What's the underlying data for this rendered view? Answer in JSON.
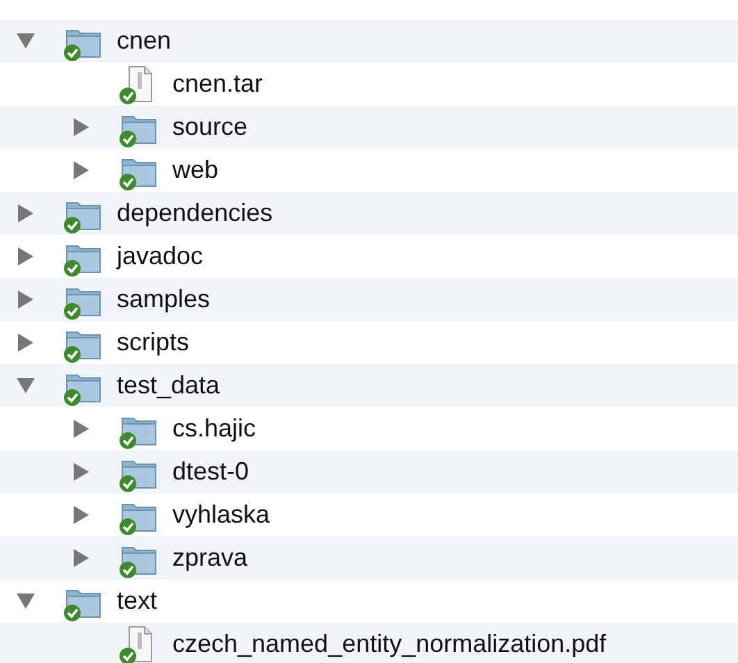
{
  "tree": [
    {
      "kind": "folder",
      "label": "cnen",
      "expanded": true,
      "children": [
        {
          "kind": "file",
          "label": "cnen.tar"
        },
        {
          "kind": "folder",
          "label": "source",
          "expanded": false
        },
        {
          "kind": "folder",
          "label": "web",
          "expanded": false
        }
      ]
    },
    {
      "kind": "folder",
      "label": "dependencies",
      "expanded": false
    },
    {
      "kind": "folder",
      "label": "javadoc",
      "expanded": false
    },
    {
      "kind": "folder",
      "label": "samples",
      "expanded": false
    },
    {
      "kind": "folder",
      "label": "scripts",
      "expanded": false
    },
    {
      "kind": "folder",
      "label": "test_data",
      "expanded": true,
      "children": [
        {
          "kind": "folder",
          "label": "cs.hajic",
          "expanded": false
        },
        {
          "kind": "folder",
          "label": "dtest-0",
          "expanded": false
        },
        {
          "kind": "folder",
          "label": "vyhlaska",
          "expanded": false
        },
        {
          "kind": "folder",
          "label": "zprava",
          "expanded": false
        }
      ]
    },
    {
      "kind": "folder",
      "label": "text",
      "expanded": true,
      "children": [
        {
          "kind": "file",
          "label": "czech_named_entity_normalization.pdf"
        }
      ]
    }
  ]
}
